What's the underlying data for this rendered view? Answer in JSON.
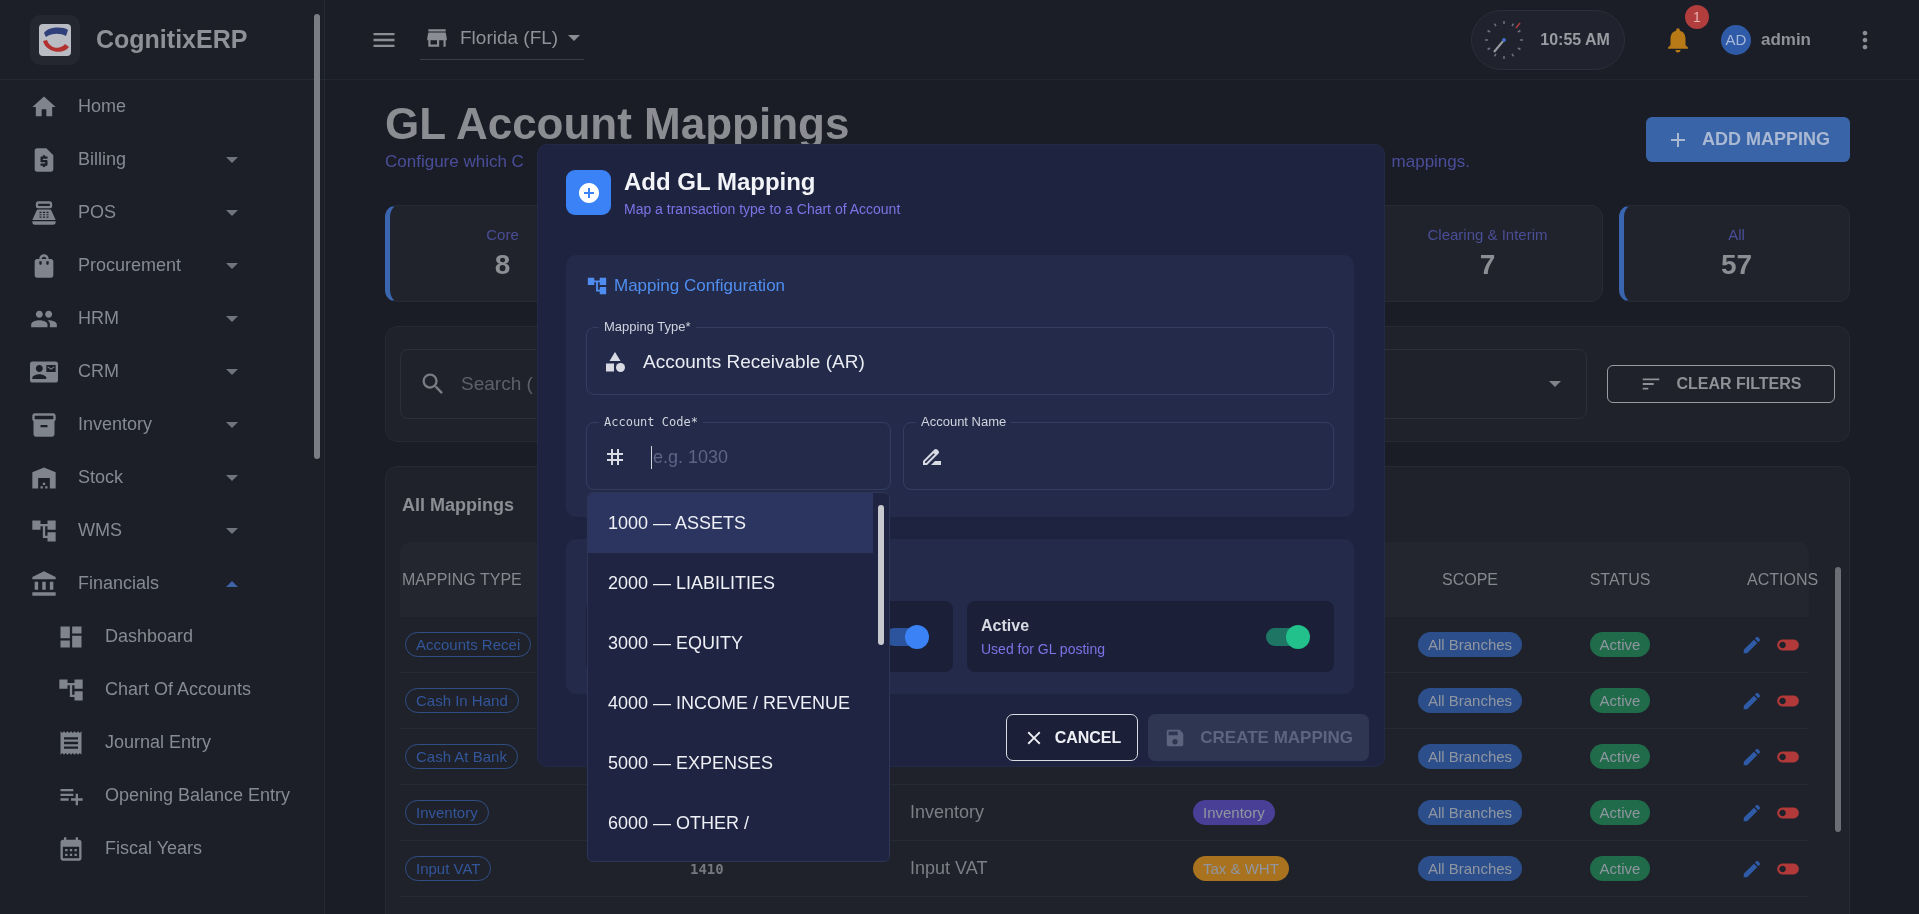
{
  "sidebar": {
    "brand": "CognitixERP",
    "items": [
      {
        "label": "Home"
      },
      {
        "label": "Billing",
        "expanded": false
      },
      {
        "label": "POS",
        "expanded": false
      },
      {
        "label": "Procurement",
        "expanded": false
      },
      {
        "label": "HRM",
        "expanded": false
      },
      {
        "label": "CRM",
        "expanded": false
      },
      {
        "label": "Inventory",
        "expanded": false
      },
      {
        "label": "Stock",
        "expanded": false
      },
      {
        "label": "WMS",
        "expanded": false
      },
      {
        "label": "Financials",
        "expanded": true,
        "children": [
          {
            "label": "Dashboard"
          },
          {
            "label": "Chart Of Accounts"
          },
          {
            "label": "Journal Entry"
          },
          {
            "label": "Opening Balance Entry"
          },
          {
            "label": "Fiscal Years"
          }
        ]
      }
    ]
  },
  "topbar": {
    "branch": "Florida (FL)",
    "time": "10:55 AM",
    "notifications": "1",
    "avatar": "AD",
    "user": "admin"
  },
  "page": {
    "title": "GL Account Mappings",
    "subtitle_start": "Configure which C",
    "subtitle_end": "mappings.",
    "add_button": "ADD MAPPING"
  },
  "stats": [
    {
      "label": "Core",
      "value": "8",
      "selected": true
    },
    {
      "label": "Clearing & Interim",
      "value": "7",
      "selected": false
    },
    {
      "label": "All",
      "value": "57",
      "selected": true
    }
  ],
  "filters": {
    "search_placeholder": "Search (",
    "clear_button": "CLEAR FILTERS"
  },
  "table": {
    "title": "All Mappings",
    "columns": {
      "mapping_type": "MAPPING TYPE",
      "scope": "SCOPE",
      "status": "STATUS",
      "actions": "ACTIONS"
    },
    "rows": [
      {
        "mapping_type": "Accounts Recei",
        "scope": "All Branches",
        "status": "Active"
      },
      {
        "mapping_type": "Cash In Hand",
        "scope": "All Branches",
        "status": "Active"
      },
      {
        "mapping_type": "Cash At Bank",
        "scope": "All Branches",
        "status": "Active"
      },
      {
        "mapping_type": "Inventory",
        "account_name": "Inventory",
        "category": {
          "label": "Inventory",
          "color": "#4a3f96"
        },
        "scope": "All Branches",
        "status": "Active"
      },
      {
        "mapping_type": "Input VAT",
        "code": "1410",
        "account_name": "Input VAT",
        "category": {
          "label": "Tax & WHT",
          "color": "#a8721f"
        },
        "scope": "All Branches",
        "status": "Active"
      }
    ]
  },
  "modal": {
    "title": "Add GL Mapping",
    "subtitle": "Map a transaction type to a Chart of Account",
    "section_title": "Mapping Configuration",
    "mapping_type": {
      "label": "Mapping Type*",
      "value": "Accounts Receivable (AR)"
    },
    "account_code": {
      "label": "Account Code*",
      "placeholder": "e.g. 1030"
    },
    "account_name": {
      "label": "Account Name"
    },
    "options": [
      {
        "on": true,
        "color": "#3b82f6"
      },
      {
        "title": "Active",
        "description": "Used for GL posting",
        "on": true,
        "color": "#22c08a"
      }
    ],
    "cancel": "CANCEL",
    "submit": {
      "label": "CREATE MAPPING",
      "disabled": true
    }
  },
  "account_dropdown": [
    {
      "label": "1000 — ASSETS",
      "selected": true
    },
    {
      "label": "2000 — LIABILITIES",
      "selected": false
    },
    {
      "label": "3000 — EQUITY",
      "selected": false
    },
    {
      "label": "4000 — INCOME / REVENUE",
      "selected": false
    },
    {
      "label": "5000 — EXPENSES",
      "selected": false
    },
    {
      "label": "6000 — OTHER /",
      "selected": false
    }
  ]
}
